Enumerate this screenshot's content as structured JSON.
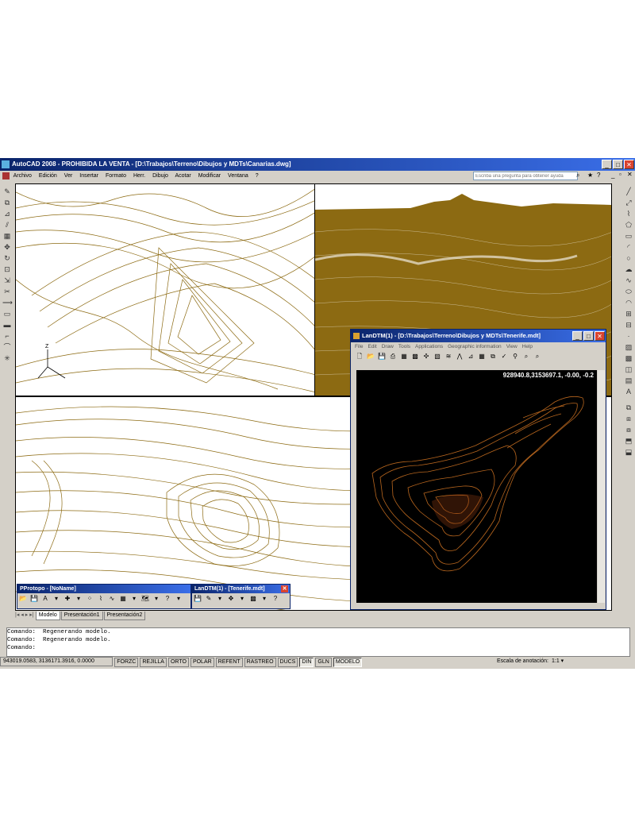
{
  "app": {
    "title": "AutoCAD 2008 - PROHIBIDA LA VENTA - [D:\\Trabajos\\Terreno\\Dibujos y MDTs\\Canarias.dwg]",
    "menu": [
      "Archivo",
      "Edición",
      "Ver",
      "Insertar",
      "Formato",
      "Herr.",
      "Dibujo",
      "Acotar",
      "Modificar",
      "Ventana",
      "?"
    ],
    "help_placeholder": "Escriba una pregunta para obtener ayuda"
  },
  "layout_tabs": [
    "Modelo",
    "Presentación1",
    "Presentación2"
  ],
  "command_history": [
    "Comando:  Regenerando modelo.",
    "Comando:  Regenerando modelo."
  ],
  "command_prompt": "Comando:",
  "status": {
    "coords": "943019.0583, 3136171.3916, 0.0000",
    "buttons": [
      "FORZC",
      "REJILLA",
      "ORTO",
      "POLAR",
      "REFENT",
      "RASTREO",
      "DUCS",
      "DIN",
      "GLN",
      "MODELO"
    ],
    "annotation_scale_label": "Escala de anotación:",
    "annotation_scale_value": "1:1 ▾"
  },
  "landtm_window": {
    "title": "LanDTM(1) - [D:\\Trabajos\\Terreno\\Dibujos y MDTs\\Tenerife.mdt]",
    "menu": [
      "File",
      "Edit",
      "Draw",
      "Tools",
      "Applications",
      "Geographic information",
      "View",
      "Help"
    ],
    "coord_readout": "928940.8,3153697.1, -0.00, -0.2"
  },
  "float_toolbars": [
    {
      "title": "PProtopo - [NoName]"
    },
    {
      "title": "LanDTM(1) - [Tenerife.mdt]"
    }
  ],
  "colors": {
    "terrain": "#8c6a12",
    "terrain_orange": "#b8661e",
    "title_blue": "#0a246a"
  }
}
